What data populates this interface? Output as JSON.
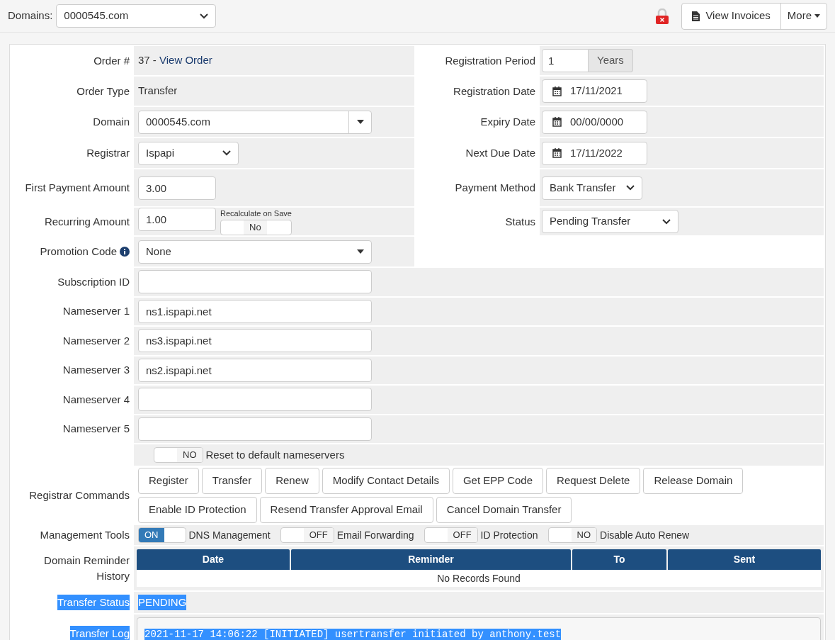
{
  "top_bar": {
    "domains_label": "Domains:",
    "domain_select": "0000545.com",
    "view_invoices": "View Invoices",
    "more": "More"
  },
  "left_fields": [
    {
      "kind": "link",
      "label": "Order #",
      "prefix": "37 - ",
      "link": "View Order"
    },
    {
      "kind": "text",
      "label": "Order Type",
      "value": "Transfer"
    },
    {
      "kind": "combo",
      "label": "Domain",
      "value": "0000545.com"
    },
    {
      "kind": "select",
      "label": "Registrar",
      "value": "Ispapi"
    },
    {
      "kind": "input",
      "label": "First Payment Amount",
      "value": "3.00"
    },
    {
      "kind": "recalc",
      "label": "Recurring Amount",
      "value": "1.00",
      "recalc_label": "Recalculate on Save",
      "toggle": {
        "on": false,
        "text": "No"
      }
    },
    {
      "kind": "promo",
      "label": "Promotion Code",
      "value": "None"
    }
  ],
  "right_fields": [
    {
      "kind": "period",
      "label": "Registration Period",
      "value": "1",
      "addon": "Years"
    },
    {
      "kind": "date",
      "label": "Registration Date",
      "value": "17/11/2021"
    },
    {
      "kind": "date",
      "label": "Expiry Date",
      "value": "00/00/0000"
    },
    {
      "kind": "date",
      "label": "Next Due Date",
      "value": "17/11/2022"
    },
    {
      "kind": "select",
      "label": "Payment Method",
      "value": "Bank Transfer"
    },
    {
      "kind": "select",
      "label": "Status",
      "value": "Pending Transfer"
    }
  ],
  "wide_fields": [
    {
      "label": "Subscription ID"
    },
    {
      "label": "Nameserver 1",
      "value": "ns1.ispapi.net"
    },
    {
      "label": "Nameserver 2",
      "value": "ns3.ispapi.net"
    },
    {
      "label": "Nameserver 3",
      "value": "ns2.ispapi.net"
    },
    {
      "label": "Nameserver 4"
    },
    {
      "label": "Nameserver 5"
    }
  ],
  "reset_nameservers": {
    "on": false,
    "text": "NO",
    "label": "Reset to default nameservers"
  },
  "registrar_commands": {
    "label": "Registrar Commands",
    "buttons": [
      [
        "Register",
        "Transfer",
        "Renew",
        "Modify Contact Details",
        "Get EPP Code",
        "Request Delete",
        "Release Domain"
      ],
      [
        "Enable ID Protection",
        "Resend Transfer Approval Email",
        "Cancel Domain Transfer"
      ]
    ]
  },
  "management_tools": {
    "label": "Management Tools",
    "toggles": [
      {
        "on": true,
        "text": "ON",
        "label": "DNS Management"
      },
      {
        "on": false,
        "text": "OFF",
        "label": "Email Forwarding"
      },
      {
        "on": false,
        "text": "OFF",
        "label": "ID Protection"
      },
      {
        "on": false,
        "text": "NO",
        "label": "Disable Auto Renew"
      }
    ]
  },
  "reminder_history": {
    "label": "Domain Reminder History",
    "columns": [
      "Date",
      "Reminder",
      "To",
      "Sent"
    ],
    "empty_message": "No Records Found"
  },
  "transfer_status": {
    "label": "Transfer Status",
    "value": "PENDING",
    "highlighted": true
  },
  "transfer_log": {
    "label": "Transfer Log",
    "value": "2021-11-17 14:06:22 [INITIATED] usertransfer initiated by anthony.test",
    "highlighted": true
  }
}
